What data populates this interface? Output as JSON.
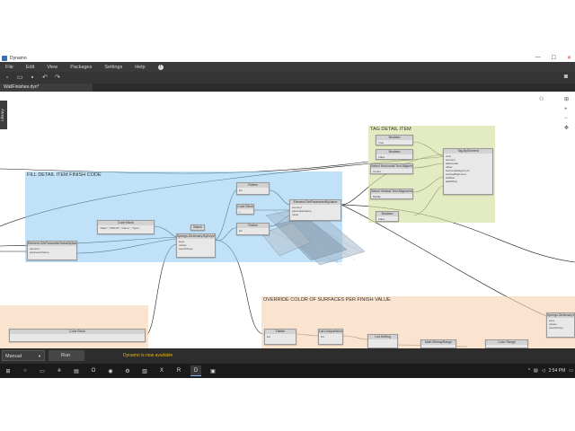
{
  "window": {
    "title": "Dynamo",
    "controls": [
      "—",
      "☐",
      "✕"
    ]
  },
  "menu": [
    "File",
    "Edit",
    "View",
    "Packages",
    "Settings",
    "Help"
  ],
  "tab": {
    "label": "WallFinishes.dyn*"
  },
  "library_label": "Library",
  "groups": {
    "fill": "FILL DETAIL ITEM FINISH CODE",
    "tag": "TAG DETAIL ITEM",
    "override": "OVERRIDE COLOR OF SURFACES PER FINISH VALUE"
  },
  "nodes": {
    "code_block_1": {
      "title": "Code Block",
      "lines": [
        "\"Mark\"; \"MKFIN\"; \"Name\"; \"Type\";"
      ]
    },
    "get_param": {
      "title": "Element.GetParameterValueByName",
      "ports": [
        "element",
        "parameterName"
      ],
      "out": "var[]..."
    },
    "dict_by_keys": {
      "title": "Springs.Dictionary.ByKeysValues",
      "ports": [
        "keys",
        "values",
        "searchKeys"
      ],
      "out": "values"
    },
    "flatten_1": {
      "title": "Flatten",
      "ports": [
        "list"
      ],
      "out": "var[]..."
    },
    "code_block_2": {
      "title": "Code Block",
      "ports": [
        "x"
      ]
    },
    "flatten_2": {
      "title": "Flatten",
      "ports": [
        "list"
      ],
      "out": "var[]..."
    },
    "set_param": {
      "title": "Element.SetParameterByName",
      "ports": [
        "element",
        "parameterName",
        "value"
      ],
      "out": "Element"
    },
    "watch": {
      "title": "Watch"
    },
    "boolean_1": {
      "title": "Boolean",
      "options": [
        "True",
        "False"
      ]
    },
    "boolean_2": {
      "title": "Boolean",
      "options": [
        "True",
        "False"
      ]
    },
    "select_horizontal": {
      "title": "Select Horizontal Text Alignment",
      "options": [
        "Center",
        "Horizontal Alignment"
      ]
    },
    "select_vertical": {
      "title": "Select Vertical Text Alignment",
      "options": [
        "Middle",
        "Vertical Alignment"
      ]
    },
    "boolean_3": {
      "title": "Boolean",
      "options": [
        "True",
        "False"
      ]
    },
    "tag_element": {
      "title": "Tag.ByElement",
      "ports": [
        "view",
        "element",
        "addLeader",
        "offset",
        "horizontalAlignment",
        "verticalAlignment",
        "isOffset",
        "addOffset"
      ],
      "out": "Tag"
    },
    "code_block_3": {
      "title": "Code Block"
    },
    "flatten_3": {
      "title": "Flatten",
      "ports": [
        "list"
      ]
    },
    "list_unique": {
      "title": "List.UniqueItems",
      "ports": [
        "list"
      ]
    },
    "list_setting": {
      "title": "List.Setting"
    },
    "math_remap": {
      "title": "Math.RemapRange"
    },
    "color_range": {
      "title": "Color Range"
    },
    "springs_dict_2": {
      "title": "Springs.Dictionary.ByKeys",
      "ports": [
        "keys",
        "values",
        "searchKeys"
      ]
    }
  },
  "run": {
    "mode": "Manual",
    "button": "Run"
  },
  "status": "Dynamo is now available",
  "taskbar": {
    "time": "2:54 PM"
  }
}
